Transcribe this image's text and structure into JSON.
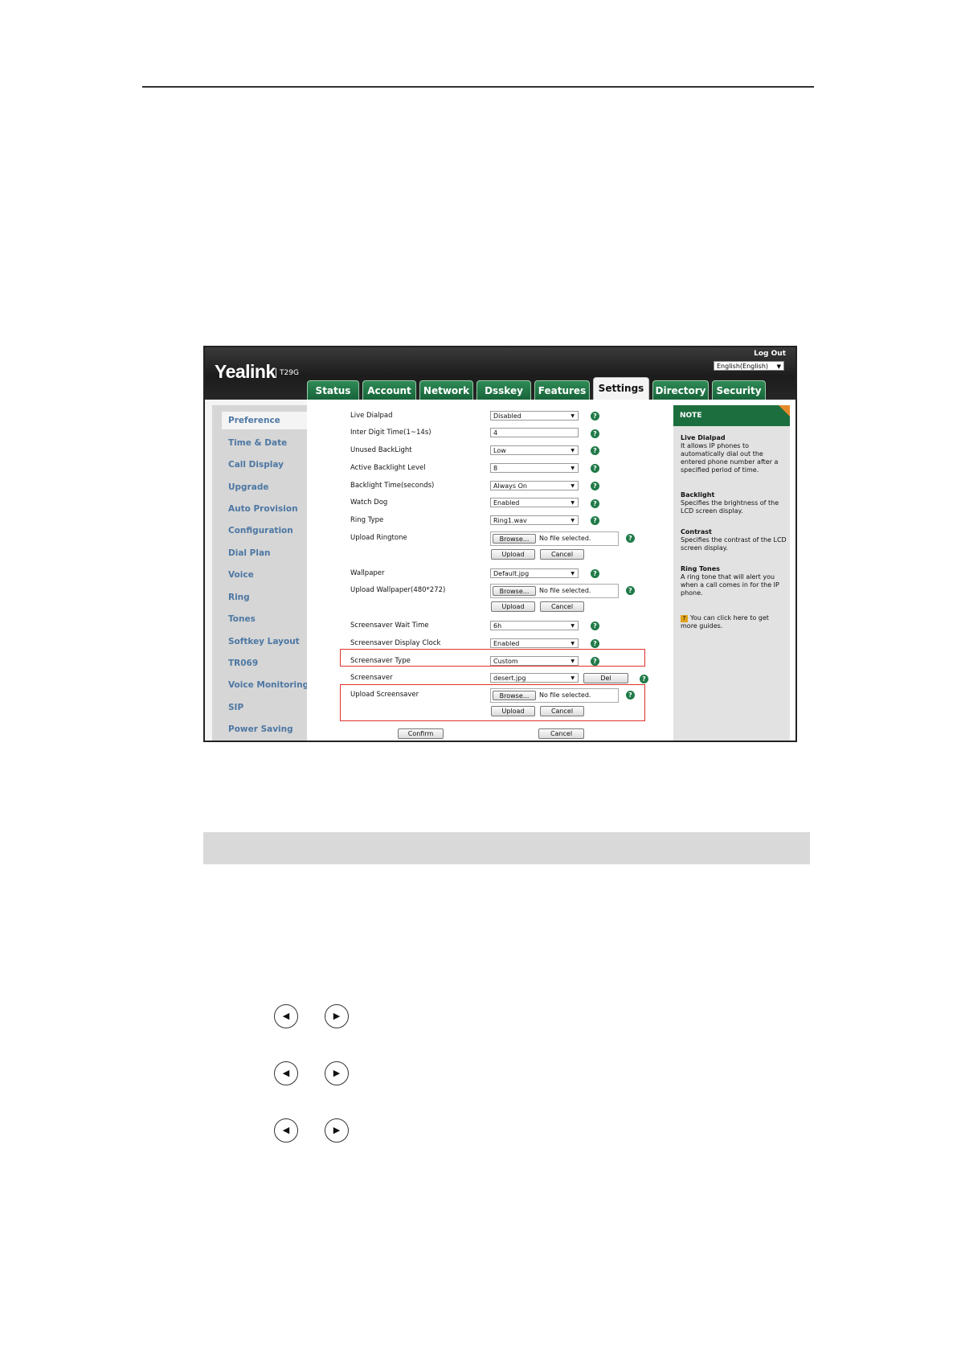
{
  "app": {
    "logo": "Yealink",
    "model": "T29G",
    "logout": "Log Out",
    "language": "English(English)"
  },
  "tabs": [
    "Status",
    "Account",
    "Network",
    "Dsskey",
    "Features",
    "Settings",
    "Directory",
    "Security"
  ],
  "active_tab": "Settings",
  "sidebar": {
    "items": [
      "Preference",
      "Time & Date",
      "Call Display",
      "Upgrade",
      "Auto Provision",
      "Configuration",
      "Dial Plan",
      "Voice",
      "Ring",
      "Tones",
      "Softkey Layout",
      "TR069",
      "Voice Monitoring",
      "SIP",
      "Power Saving"
    ],
    "active": "Preference"
  },
  "form": {
    "live_dialpad": {
      "label": "Live Dialpad",
      "value": "Disabled"
    },
    "inter_digit": {
      "label": "Inter Digit Time(1~14s)",
      "value": "4"
    },
    "unused_backlight": {
      "label": "Unused BackLight",
      "value": "Low"
    },
    "active_backlight": {
      "label": "Active Backlight Level",
      "value": "8"
    },
    "backlight_time": {
      "label": "Backlight Time(seconds)",
      "value": "Always On"
    },
    "watch_dog": {
      "label": "Watch Dog",
      "value": "Enabled"
    },
    "ring_type": {
      "label": "Ring Type",
      "value": "Ring1.wav"
    },
    "upload_ringtone": {
      "label": "Upload Ringtone"
    },
    "wallpaper": {
      "label": "Wallpaper",
      "value": "Default.jpg"
    },
    "upload_wallpaper": {
      "label": "Upload Wallpaper(480*272)"
    },
    "screensaver_wait": {
      "label": "Screensaver Wait Time",
      "value": "6h"
    },
    "screensaver_clock": {
      "label": "Screensaver Display Clock",
      "value": "Enabled"
    },
    "screensaver_type": {
      "label": "Screensaver Type",
      "value": "Custom"
    },
    "screensaver": {
      "label": "Screensaver",
      "value": "desert.jpg"
    },
    "upload_screensaver": {
      "label": "Upload Screensaver"
    },
    "browse_label": "Browse...",
    "no_file": "No file selected.",
    "upload_label": "Upload",
    "cancel_label": "Cancel",
    "del_label": "Del",
    "confirm_label": "Confirm"
  },
  "note": {
    "title": "NOTE",
    "live_dialpad_title": "Live Dialpad",
    "live_dialpad_text": "It allows IP phones to automatically dial out the entered phone number after a specified period of time.",
    "backlight_title": "Backlight",
    "backlight_text": "Specifies the brightness of the LCD screen display.",
    "contrast_title": "Contrast",
    "contrast_text": "Specifies the contrast of the LCD screen display.",
    "ringtones_title": "Ring Tones",
    "ringtones_text": "A ring tone that will alert you when a call comes in for the IP phone.",
    "guide_text": "You can click here to get more guides."
  },
  "colors": {
    "tab_green": "#18643b",
    "link_blue": "#4d77a3",
    "highlight_red": "#e0322c",
    "help_green": "#1f7a47"
  }
}
